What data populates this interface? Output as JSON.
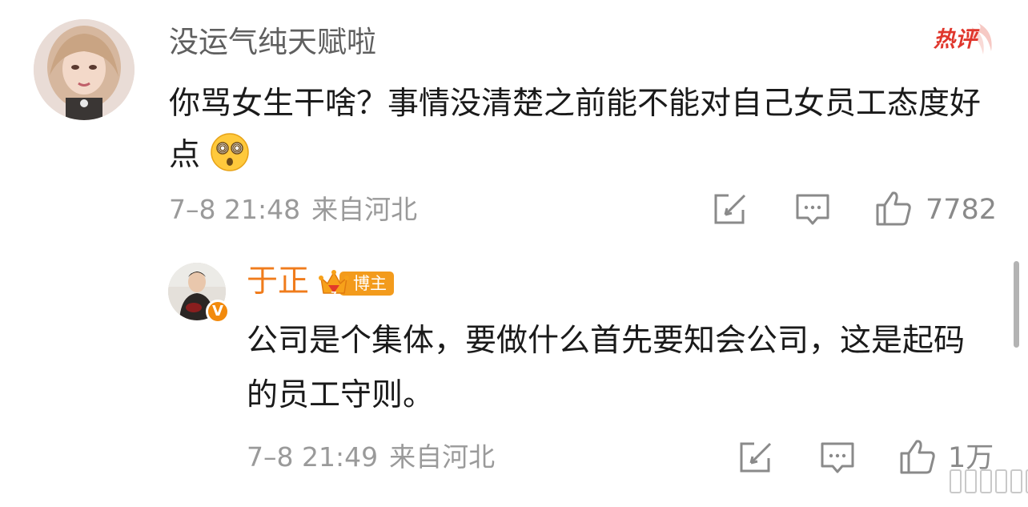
{
  "comment": {
    "username": "没运气纯天赋啦",
    "hot_badge": "热评",
    "text": "你骂女生干啥？事情没清楚之前能不能对自己女员工态度好点",
    "emoji": "dizzy-face-emoji",
    "time": "7–8 21:48",
    "location": "来自河北",
    "likes": "7782"
  },
  "reply": {
    "username": "于正",
    "badge": "博主",
    "verified_mark": "V",
    "text": "公司是个集体，要做什么首先要知会公司，这是起码的员工守则。",
    "time": "7–8 21:49",
    "location": "来自河北",
    "likes": "1万"
  },
  "colors": {
    "username_gray": "#5f5f5f",
    "meta_gray": "#9a9a9a",
    "hot_red": "#e0362c",
    "reply_name_orange": "#f07c1c",
    "badge_orange": "#f39b1c"
  }
}
